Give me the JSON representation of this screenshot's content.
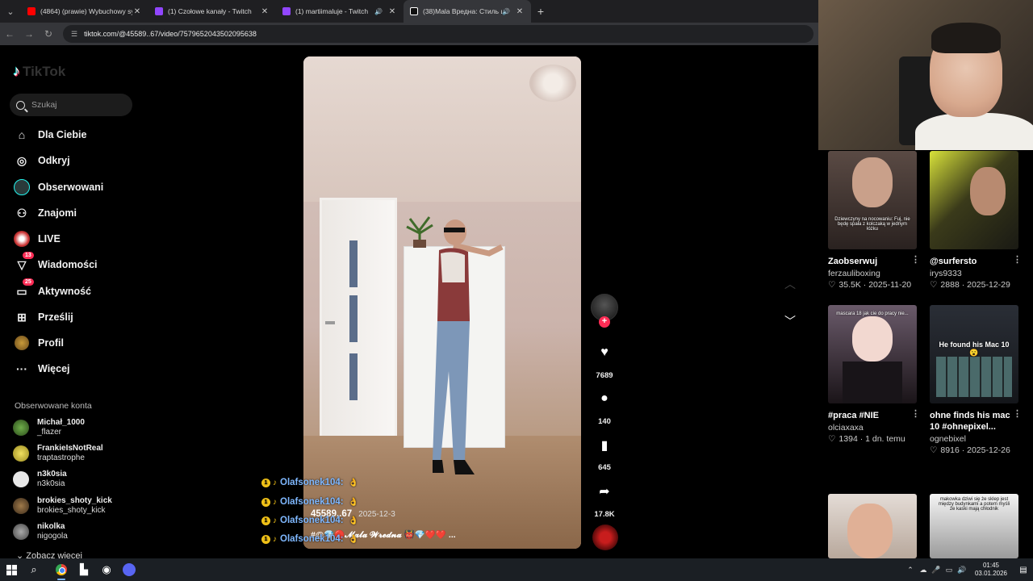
{
  "browser": {
    "tabs": [
      {
        "title": "(4864) (prawie) Wybuchowy syl",
        "favicon_color": "#ff0000",
        "active": false
      },
      {
        "title": "(1) Czołowe kanały - Twitch",
        "favicon_color": "#9146ff",
        "active": false
      },
      {
        "title": "(1) martiimaluje - Twitch",
        "favicon_color": "#9146ff",
        "active": false
      },
      {
        "title": "(38)Mala Вредна: Стиль и А",
        "favicon_color": "#ffffff",
        "active": true
      }
    ],
    "url": "tiktok.com/@45589..67/video/7579652043502095638"
  },
  "tiktok": {
    "logo_text": "TikTok",
    "search_placeholder": "Szukaj",
    "nav": [
      {
        "label": "Dla Ciebie",
        "icon": "home-icon"
      },
      {
        "label": "Odkryj",
        "icon": "compass-icon"
      },
      {
        "label": "Obserwowani",
        "icon": "following-avatar-icon"
      },
      {
        "label": "Znajomi",
        "icon": "friends-icon"
      },
      {
        "label": "LIVE",
        "icon": "live-icon"
      },
      {
        "label": "Wiadomości",
        "icon": "inbox-icon",
        "badge": "13"
      },
      {
        "label": "Aktywność",
        "icon": "activity-icon",
        "badge": "25"
      },
      {
        "label": "Prześlij",
        "icon": "upload-icon"
      },
      {
        "label": "Profil",
        "icon": "profile-icon"
      },
      {
        "label": "Więcej",
        "icon": "more-icon"
      }
    ],
    "following_title": "Obserwowane konta",
    "following": [
      {
        "name": "Michał_1000",
        "handle": "_flazer",
        "color": "#3a6b2a"
      },
      {
        "name": "FrankieIsNotReal",
        "handle": "traptastrophe",
        "color": "#c9c23a"
      },
      {
        "name": "n3k0sia",
        "handle": "n3k0sia",
        "color": "#dddddd"
      },
      {
        "name": "brokies_shoty_kick",
        "handle": "brokies_shoty_kick",
        "color": "#6a4a2a"
      },
      {
        "name": "nikolka",
        "handle": "nigogola",
        "color": "#777777"
      }
    ],
    "see_more": "Zobacz więcej"
  },
  "video": {
    "author": "45589..67",
    "date": "2025-12-3",
    "caption": "#@💎🔴𝓜𝓪𝓵𝓪 𝓦𝓻𝓮𝓭𝓷𝓪 👹💎❤️❤️ ...",
    "likes": "7689",
    "comments": "140",
    "bookmarks": "645",
    "shares": "17.8K"
  },
  "chat": [
    {
      "user": "Olafsonek104:",
      "emote": "👌"
    },
    {
      "user": "Olafsonek104:",
      "emote": "👌"
    },
    {
      "user": "Olafsonek104:",
      "emote": "👌"
    },
    {
      "user": "Olafsonek104:",
      "emote": "👌"
    }
  ],
  "recommendations": [
    {
      "title": "Zaobserwuj",
      "user": "ferzauliboxing",
      "likes": "35.5K",
      "date": "2025-11-20",
      "overlay": "Dziewczyny na nocowaniu: Fuj, nie będę spała z kolczaką w jednym łóżku",
      "bg": "#3b3532"
    },
    {
      "title": "@surfersto",
      "user": "irys9333",
      "likes": "2888",
      "date": "2025-12-29",
      "overlay": "",
      "bg": "#3a3a1f"
    },
    {
      "title": "#praca #NIE",
      "user": "olciaxaxa",
      "likes": "1394",
      "date": "1 dn. temu",
      "overlay": "mascara 18 jak cie do pracy nie...",
      "bg": "#4a3d4a"
    },
    {
      "title": "ohne finds his mac 10 #ohnepixel...",
      "user": "ognebixel",
      "likes": "8916",
      "date": "2025-12-26",
      "overlay": "He found his Mac 10 😮",
      "bg": "#23262c"
    },
    {
      "title": "",
      "user": "",
      "likes": "",
      "date": "",
      "overlay": "",
      "bg": "#d8d2cd"
    },
    {
      "title": "",
      "user": "",
      "likes": "",
      "date": "",
      "overlay": "makowka dziwi się że sklep jest między budynkami a potem myśli że kaski mają chłodnik",
      "bg": "#c9c9c9"
    }
  ],
  "taskbar": {
    "time": "01:45",
    "date": "03.01.2026"
  }
}
